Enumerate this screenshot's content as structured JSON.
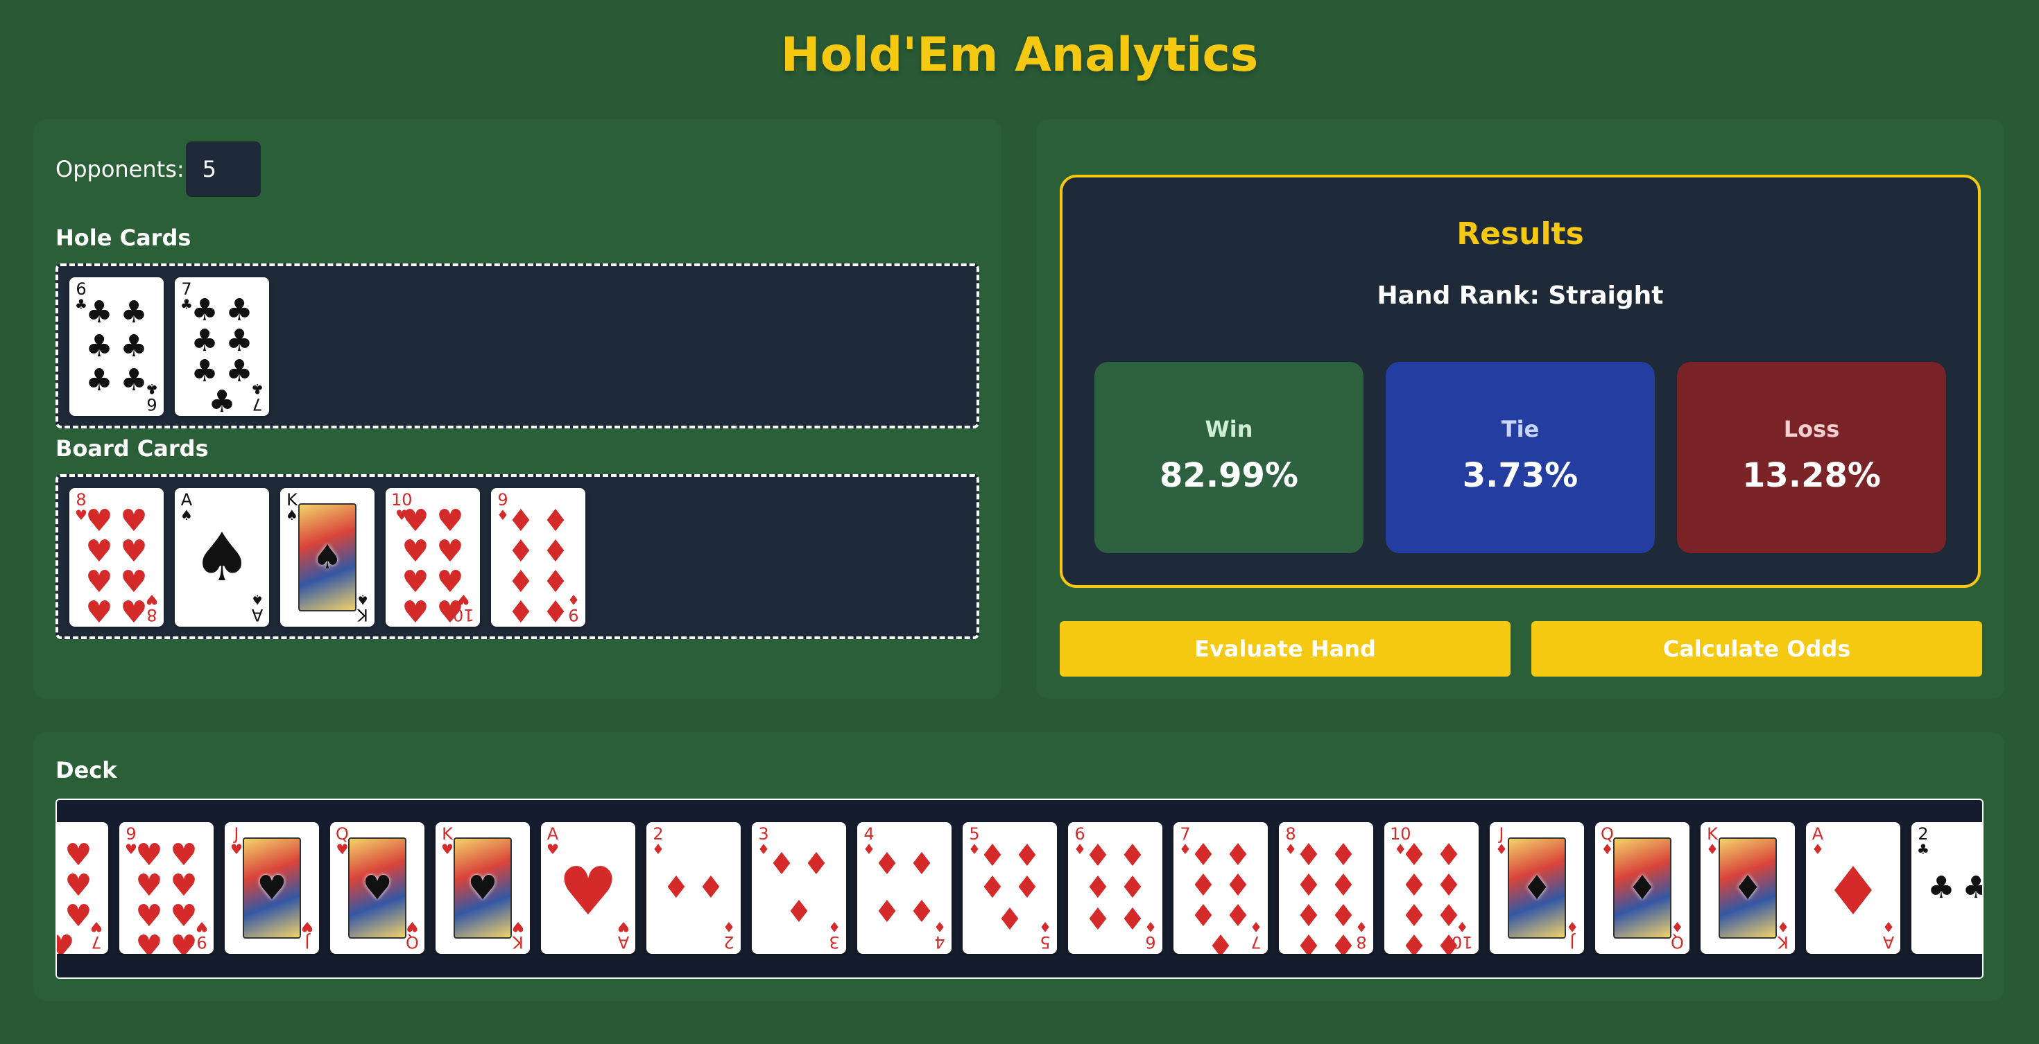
{
  "app": {
    "title": "Hold'Em Analytics"
  },
  "controls": {
    "opponents_label": "Opponents:",
    "opponents_value": "5"
  },
  "hole": {
    "label": "Hole Cards",
    "cards": [
      {
        "rank": "6",
        "suit": "clubs"
      },
      {
        "rank": "7",
        "suit": "clubs"
      }
    ]
  },
  "board": {
    "label": "Board Cards",
    "cards": [
      {
        "rank": "8",
        "suit": "hearts"
      },
      {
        "rank": "A",
        "suit": "spades"
      },
      {
        "rank": "K",
        "suit": "spades"
      },
      {
        "rank": "10",
        "suit": "hearts"
      },
      {
        "rank": "9",
        "suit": "diamonds"
      }
    ]
  },
  "results": {
    "title": "Results",
    "hand_rank": "Hand Rank: Straight",
    "win_label": "Win",
    "win_value": "82.99%",
    "tie_label": "Tie",
    "tie_value": "3.73%",
    "loss_label": "Loss",
    "loss_value": "13.28%"
  },
  "actions": {
    "evaluate_label": "Evaluate Hand",
    "calculate_label": "Calculate Odds"
  },
  "deck": {
    "label": "Deck",
    "cards": [
      {
        "rank": "7",
        "suit": "hearts"
      },
      {
        "rank": "9",
        "suit": "hearts"
      },
      {
        "rank": "J",
        "suit": "hearts"
      },
      {
        "rank": "Q",
        "suit": "hearts"
      },
      {
        "rank": "K",
        "suit": "hearts"
      },
      {
        "rank": "A",
        "suit": "hearts"
      },
      {
        "rank": "2",
        "suit": "diamonds"
      },
      {
        "rank": "3",
        "suit": "diamonds"
      },
      {
        "rank": "4",
        "suit": "diamonds"
      },
      {
        "rank": "5",
        "suit": "diamonds"
      },
      {
        "rank": "6",
        "suit": "diamonds"
      },
      {
        "rank": "7",
        "suit": "diamonds"
      },
      {
        "rank": "8",
        "suit": "diamonds"
      },
      {
        "rank": "10",
        "suit": "diamonds"
      },
      {
        "rank": "J",
        "suit": "diamonds"
      },
      {
        "rank": "Q",
        "suit": "diamonds"
      },
      {
        "rank": "K",
        "suit": "diamonds"
      },
      {
        "rank": "A",
        "suit": "diamonds"
      },
      {
        "rank": "2",
        "suit": "clubs"
      }
    ]
  },
  "colors": {
    "background": "#295a35",
    "accent": "#f5c812",
    "win": "#2d6140",
    "tie": "#233ea0",
    "loss": "#7a2428",
    "red_suit": "#d42a2a"
  }
}
